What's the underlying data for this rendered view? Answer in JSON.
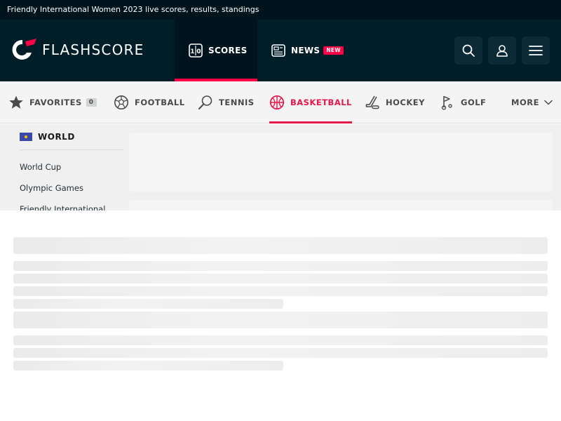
{
  "page": {
    "top_title": "Friendly International Women 2023 live scores, results, standings"
  },
  "header": {
    "logo_text": "FLASHSCORE",
    "tabs": [
      {
        "label": "SCORES",
        "active": true
      },
      {
        "label": "NEWS",
        "badge": "NEW",
        "active": false
      }
    ],
    "buttons": [
      "search",
      "user",
      "menu"
    ]
  },
  "sport_nav": {
    "items": [
      {
        "label": "FAVORITES",
        "count": "0",
        "icon": "star-icon"
      },
      {
        "label": "FOOTBALL",
        "icon": "football-icon"
      },
      {
        "label": "TENNIS",
        "icon": "tennis-icon"
      },
      {
        "label": "BASKETBALL",
        "icon": "basketball-icon",
        "active": true
      },
      {
        "label": "HOCKEY",
        "icon": "hockey-icon"
      },
      {
        "label": "GOLF",
        "icon": "golf-icon"
      },
      {
        "label": "MORE",
        "icon": "chevron-down-icon"
      }
    ]
  },
  "left_menu": {
    "region": "WORLD",
    "leagues": [
      "World Cup",
      "Olympic Games",
      "Friendly International"
    ]
  },
  "colors": {
    "dark_bg": "#001e28",
    "top_bar": "#00141e",
    "accent": "#ff0046",
    "basketball_accent": "#e8174a"
  }
}
